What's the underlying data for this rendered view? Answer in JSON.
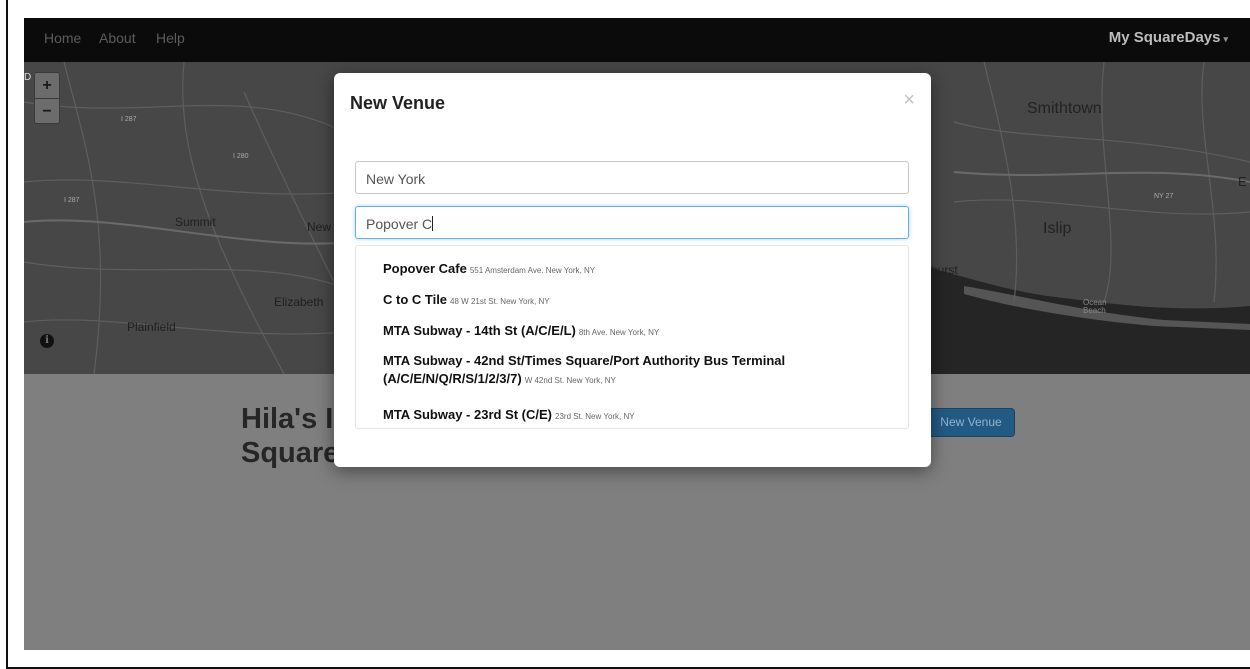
{
  "navbar": {
    "links": [
      "Home",
      "About",
      "Help"
    ],
    "user_menu": "My SquareDays",
    "user_menu_caret": "▾"
  },
  "map": {
    "zoom_in": "+",
    "zoom_out": "−",
    "info": "i",
    "labels": {
      "smithtown": "Smithtown",
      "summit": "Summit",
      "new": "New",
      "islip": "Islip",
      "elizabeth": "Elizabeth",
      "plainfield": "Plainfield",
      "hurst": "hurst",
      "ocean_beach": "Ocean\nBeach",
      "e": "E",
      "d": "D",
      "route_287a": "I 287",
      "route_280": "I 280",
      "route_287b": "I 287",
      "ny27": "NY 27"
    }
  },
  "page": {
    "heading_line1": "Hila's I",
    "heading_line2": "Square",
    "new_venue_button": "New Venue"
  },
  "modal": {
    "title": "New Venue",
    "close": "×",
    "city_value": "New York",
    "venue_value": "Popover C",
    "suggestions": [
      {
        "name": "Popover Cafe",
        "address": "551 Amsterdam Ave. New York, NY"
      },
      {
        "name": "C to C Tile",
        "address": "48 W 21st St. New York, NY"
      },
      {
        "name": "MTA Subway - 14th St (A/C/E/L)",
        "address": "8th Ave. New York, NY"
      },
      {
        "name_line1": "MTA Subway - 42nd St/Times Square/Port Authority Bus Terminal",
        "name_line2": "(A/C/E/N/Q/R/S/1/2/3/7)",
        "address": "W 42nd St. New York, NY"
      },
      {
        "name": "MTA Subway - 23rd St (C/E)",
        "address": "23rd St. New York, NY"
      }
    ]
  },
  "colors": {
    "navbar_bg": "#0b0b0b",
    "overlay_bg": "#7f7f7f",
    "button_bg": "#235a84",
    "focus_ring": "#66afe9"
  }
}
